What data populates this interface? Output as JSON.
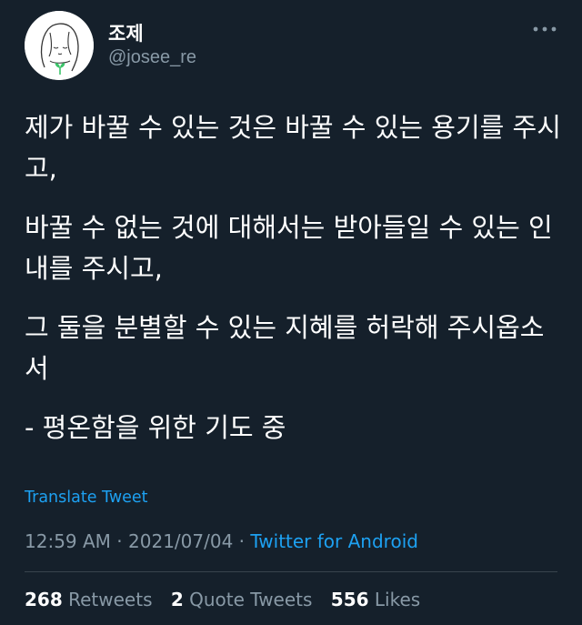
{
  "user": {
    "display_name": "조제",
    "handle": "@josee_re",
    "avatar_icon": "line-drawing-woman-with-sprout-icon"
  },
  "tweet": {
    "paragraphs": [
      "제가 바꿀 수 있는 것은 바꿀 수 있는 용기를 주시고,",
      "바꿀 수 없는 것에 대해서는 받아들일 수 있는 인내를 주시고,",
      "그 둘을 분별할 수 있는 지혜를 허락해 주시옵소서",
      "- 평온함을 위한 기도 중"
    ],
    "translate_label": "Translate Tweet",
    "time": "12:59 AM",
    "separator": " · ",
    "date": "2021/07/04",
    "source": "Twitter for Android"
  },
  "stats": {
    "retweets_count": "268",
    "retweets_label": "Retweets",
    "quotes_count": "2",
    "quotes_label": "Quote Tweets",
    "likes_count": "556",
    "likes_label": "Likes"
  },
  "colors": {
    "background": "#15202b",
    "text": "#ffffff",
    "secondary": "#8899a6",
    "accent": "#1da1f2",
    "divider": "#38444d",
    "sprout": "#3cc46a"
  },
  "icons": {
    "more": "more-horizontal-icon"
  }
}
